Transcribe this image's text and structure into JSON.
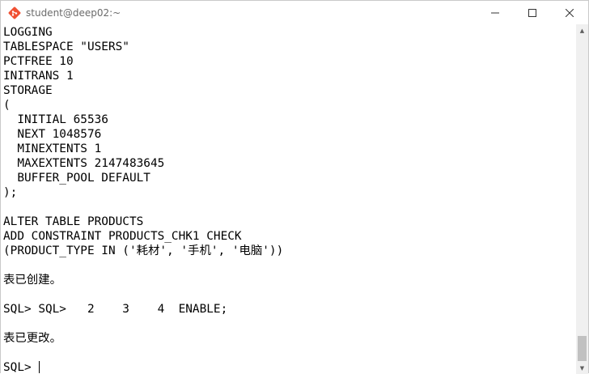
{
  "window": {
    "title": "student@deep02:~",
    "minimize_glyph": "—",
    "maximize_glyph": "☐",
    "close_glyph": "✕"
  },
  "terminal": {
    "lines": [
      "LOGGING",
      "TABLESPACE \"USERS\"",
      "PCTFREE 10",
      "INITRANS 1",
      "STORAGE",
      "(",
      "  INITIAL 65536",
      "  NEXT 1048576",
      "  MINEXTENTS 1",
      "  MAXEXTENTS 2147483645",
      "  BUFFER_POOL DEFAULT",
      ");",
      "",
      "ALTER TABLE PRODUCTS",
      "ADD CONSTRAINT PRODUCTS_CHK1 CHECK",
      "(PRODUCT_TYPE IN ('耗材', '手机', '电脑'))",
      "",
      "表已创建。",
      "",
      "SQL> SQL>   2    3    4  ENABLE;",
      "",
      "表已更改。",
      "",
      "SQL> "
    ]
  },
  "scrollbar": {
    "up_glyph": "▲",
    "down_glyph": "▼"
  },
  "colors": {
    "terminal_bg": "#ffffff",
    "terminal_fg": "#000000"
  }
}
